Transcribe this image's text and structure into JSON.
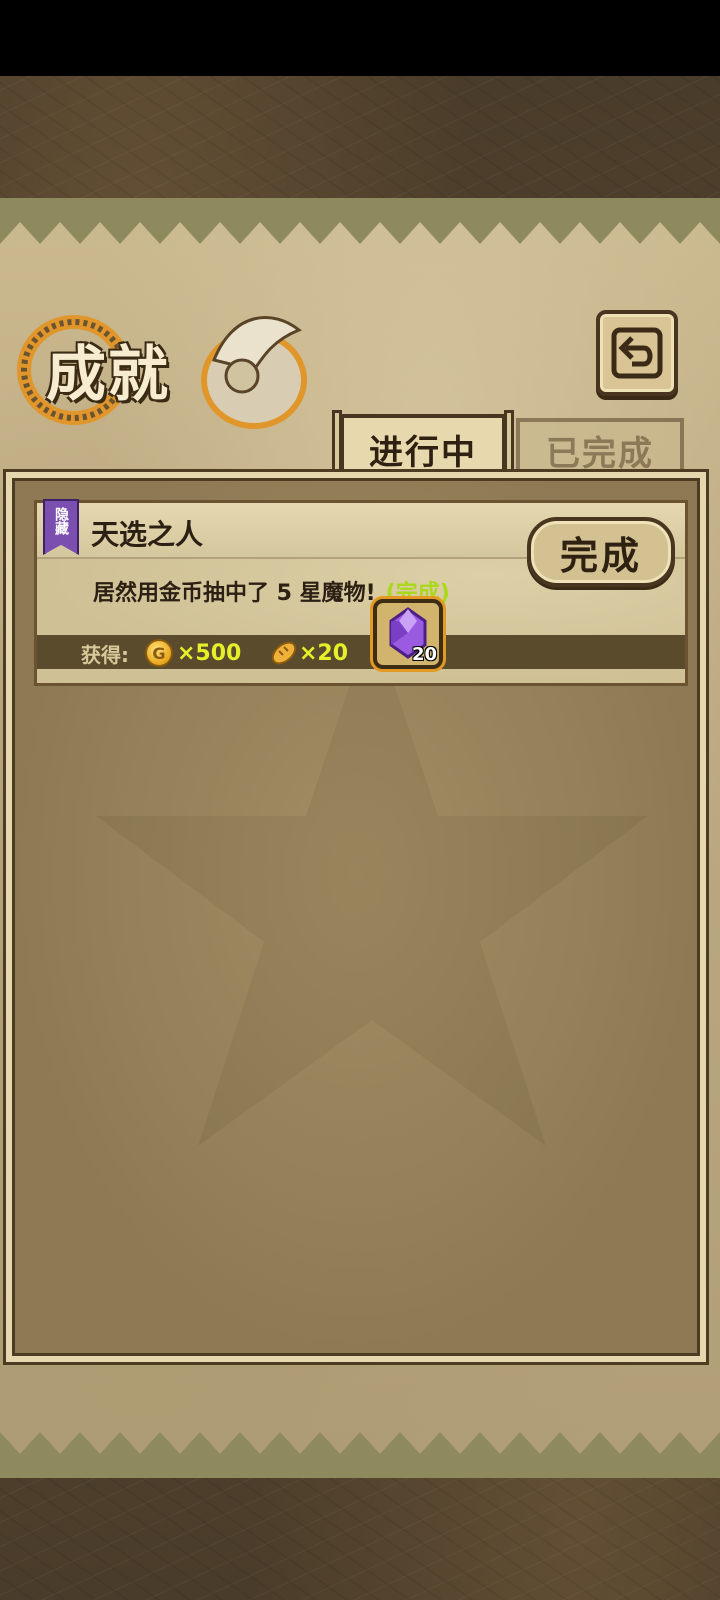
{
  "screen": {
    "title": "成就",
    "back_icon": "return-arrow-icon"
  },
  "tabs": [
    {
      "label": "进行中",
      "active": true
    },
    {
      "label": "已完成",
      "active": false
    }
  ],
  "achievements": [
    {
      "tag": "隐藏",
      "name": "天选之人",
      "description": "居然用金币抽中了 5 星魔物!",
      "status": "(完成)",
      "button_label": "完成",
      "reward_label": "获得:",
      "rewards": {
        "gold": "×500",
        "food": "×20",
        "gem_count": "20"
      }
    }
  ],
  "colors": {
    "accent": "#c9851f",
    "status": "#a9d81c",
    "reward_amount": "#e6f02a",
    "hidden_tag": "#7a4fb0"
  }
}
